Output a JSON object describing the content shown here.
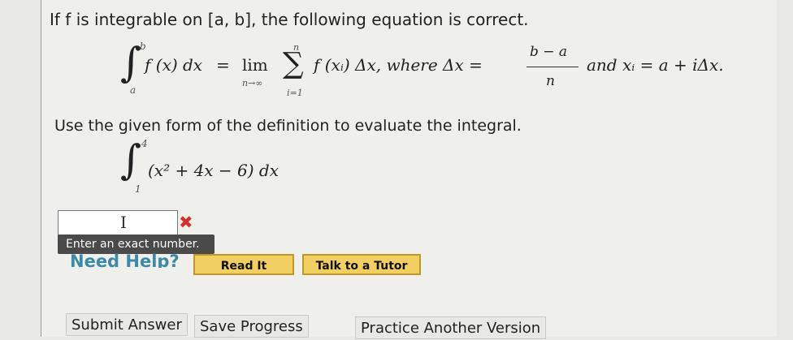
{
  "question": {
    "intro": "If f is integrable on [a, b], the following equation is correct.",
    "definition": {
      "integral_upper": "b",
      "integral_lower": "a",
      "integrand": "f (x) dx",
      "equals": "=",
      "lim": "lim",
      "lim_sub": "n→∞",
      "sum_upper": "n",
      "sum_lower": "i=1",
      "sum_term": "f (xᵢ) Δx, where Δx =",
      "frac_num": "b − a",
      "frac_den": "n",
      "tail": "and xᵢ = a + iΔx."
    },
    "prompt": "Use the given form of the definition to evaluate the integral.",
    "integral": {
      "upper": "4",
      "lower": "1",
      "expression": "(x² + 4x − 6) dx"
    }
  },
  "answer": {
    "value": "",
    "status_icon": "x-mark-icon",
    "tooltip": "Enter an exact number."
  },
  "help": {
    "label": "Need Help?",
    "read_it": "Read It",
    "talk_to_tutor": "Talk to a Tutor"
  },
  "footer": {
    "submit": "Submit Answer",
    "save": "Save Progress",
    "practice": "Practice Another Version"
  },
  "colors": {
    "error": "#d0302a",
    "help_button": "#f2cf62",
    "help_text": "#3c8aa8"
  }
}
